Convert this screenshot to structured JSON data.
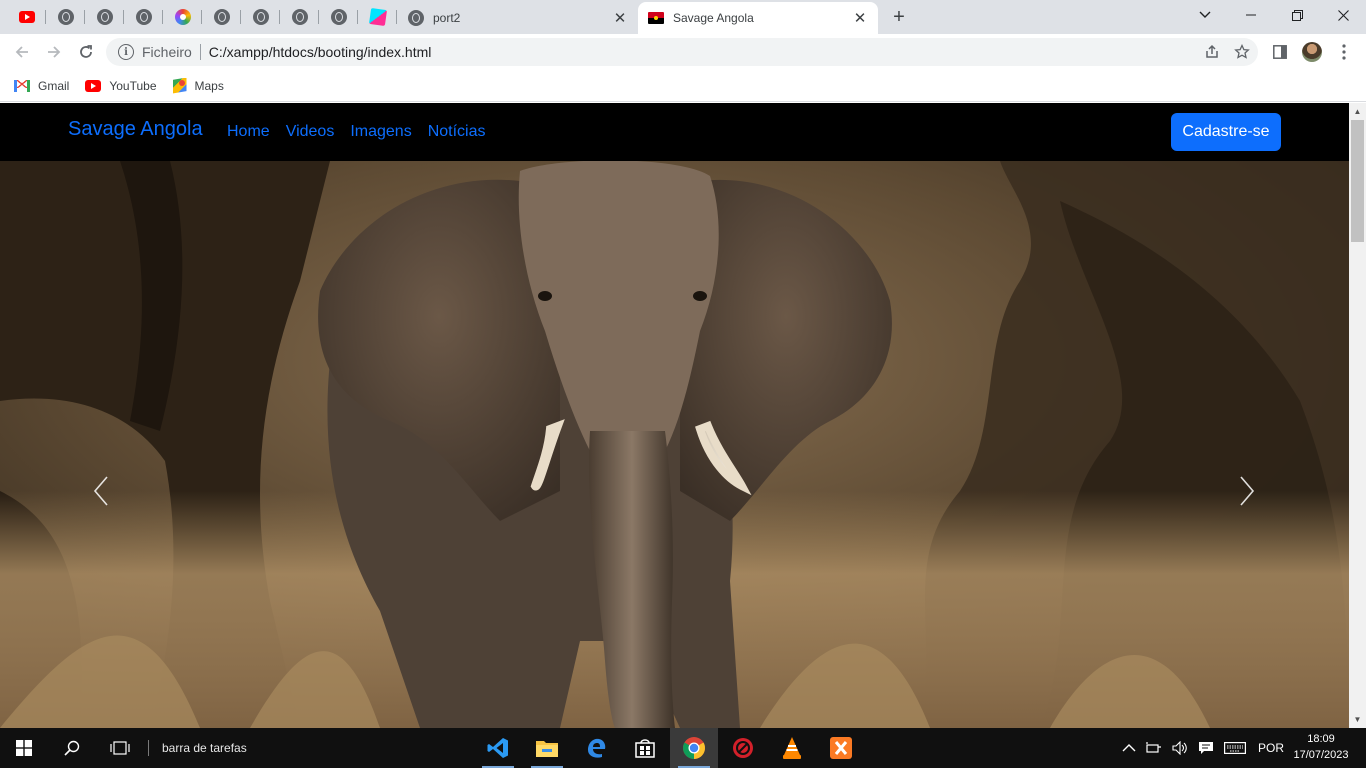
{
  "browser": {
    "tabs": [
      {
        "title": "port2",
        "icon": "globe-icon"
      },
      {
        "title": "Savage Angola",
        "icon": "angola-flag-icon",
        "active": true
      }
    ],
    "pinned_tab_icons": [
      "youtube-icon",
      "globe-icon",
      "globe-icon",
      "globe-icon",
      "color-wheel-icon",
      "globe-icon",
      "globe-icon",
      "globe-icon",
      "globe-icon",
      "cube-icon"
    ],
    "close_symbol": "✕",
    "new_tab_symbol": "+",
    "omnibox": {
      "scheme_label": "Ficheiro",
      "url": "C:/xampp/htdocs/booting/index.html"
    },
    "bookmarks": [
      {
        "label": "Gmail",
        "icon": "gmail-icon"
      },
      {
        "label": "YouTube",
        "icon": "youtube-icon"
      },
      {
        "label": "Maps",
        "icon": "maps-icon"
      }
    ]
  },
  "site": {
    "brand": "Savage Angola",
    "nav_links": [
      "Home",
      "Videos",
      "Imagens",
      "Notícias"
    ],
    "cta_label": "Cadastre-se",
    "accent_color": "#0d6efd",
    "navbar_bg": "#000000",
    "carousel": {
      "slide_image": "elephant-photo",
      "prev_icon": "chevron-left-icon",
      "next_icon": "chevron-right-icon"
    }
  },
  "taskbar": {
    "search_text": "barra de tarefas",
    "apps": [
      "vscode-icon",
      "file-explorer-icon",
      "edge-icon",
      "store-icon",
      "chrome-icon",
      "antivirus-icon",
      "vlc-icon",
      "xampp-icon"
    ],
    "language": "POR",
    "time": "18:09",
    "date": "17/07/2023"
  }
}
